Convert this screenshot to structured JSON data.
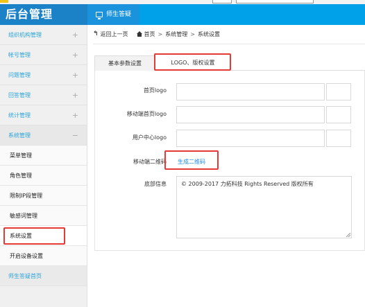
{
  "app": {
    "brand": "后台管理"
  },
  "header": {
    "tab_label": "师生答疑",
    "tab_icon": "monitor-icon"
  },
  "sidebar": {
    "items": [
      {
        "label": "组织机构管理",
        "toggle": "+"
      },
      {
        "label": "帐号管理",
        "toggle": "+"
      },
      {
        "label": "问题管理",
        "toggle": "+"
      },
      {
        "label": "回答管理",
        "toggle": "+"
      },
      {
        "label": "统计管理",
        "toggle": "+"
      },
      {
        "label": "系统管理",
        "toggle": "−"
      }
    ],
    "subitems": [
      {
        "label": "菜单管理"
      },
      {
        "label": "角色管理"
      },
      {
        "label": "限制IP段管理"
      },
      {
        "label": "敏感词管理"
      },
      {
        "label": "系统设置"
      },
      {
        "label": "开启设备设置"
      }
    ],
    "bottom_item": {
      "label": "师生答疑首页"
    }
  },
  "breadcrumb": {
    "back": "返回上一页",
    "home": "首页",
    "level1": "系统管理",
    "level2": "系统设置",
    "sep": ">"
  },
  "tabs": {
    "basic": "基本参数设置",
    "logo": "LOGO、版权设置"
  },
  "form": {
    "homepage_logo_label": "首页logo",
    "mobile_homepage_logo_label": "移动端首页logo",
    "user_center_logo_label": "用户中心logo",
    "mobile_qr_label": "移动端二维码",
    "qr_link": "生成二维码",
    "footer_label": "底部信息",
    "footer_value": "© 2009-2017 力拓科技 Rights Reserved 版权所有"
  },
  "colors": {
    "header_bg": "#00a1e9",
    "brand_bg": "#1c82c7",
    "highlight": "#e53935",
    "link": "#1e88e5"
  }
}
